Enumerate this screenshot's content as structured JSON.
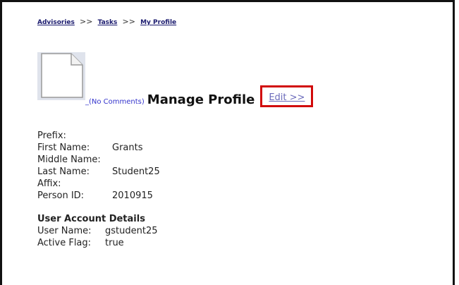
{
  "breadcrumb": {
    "items": [
      "Advisories",
      "Tasks",
      "My Profile"
    ],
    "separator": ">>"
  },
  "header": {
    "comments_link": "_(No Comments)",
    "title": "Manage Profile",
    "edit_link": "Edit >>",
    "doc_icon": "document-icon"
  },
  "personal": {
    "prefix_label": "Prefix:",
    "prefix_value": "",
    "first_name_label": "First Name:",
    "first_name_value": "Grants",
    "middle_name_label": "Middle Name:",
    "middle_name_value": "",
    "last_name_label": "Last Name:",
    "last_name_value": "Student25",
    "affix_label": "Affix:",
    "affix_value": "",
    "person_id_label": "Person ID:",
    "person_id_value": "2010915"
  },
  "account": {
    "title": "User Account Details",
    "user_name_label": "User Name:",
    "user_name_value": "gstudent25",
    "active_flag_label": "Active Flag:",
    "active_flag_value": "true"
  },
  "colors": {
    "highlight_border": "#d10a0a",
    "link": "#3333cc",
    "breadcrumb": "#1a1a6e"
  }
}
